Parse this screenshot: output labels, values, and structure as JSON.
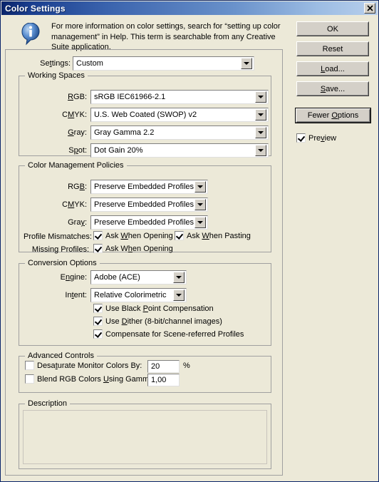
{
  "window": {
    "title": "Color Settings",
    "close_icon": "close-icon"
  },
  "info": {
    "icon": "info-icon",
    "text": "For more information on color settings, search for “setting up color management” in Help. This term is searchable from any Creative Suite application."
  },
  "settings": {
    "label": "Settings:",
    "value": "Custom"
  },
  "working_spaces": {
    "legend": "Working Spaces",
    "rows": [
      {
        "label": "RGB:",
        "value": "sRGB IEC61966-2.1"
      },
      {
        "label": "CMYK:",
        "value": "U.S. Web Coated (SWOP) v2"
      },
      {
        "label": "Gray:",
        "value": "Gray Gamma 2.2"
      },
      {
        "label": "Spot:",
        "value": "Dot Gain 20%"
      }
    ]
  },
  "color_management_policies": {
    "legend": "Color Management Policies",
    "rows": [
      {
        "label": "RGB:",
        "value": "Preserve Embedded Profiles"
      },
      {
        "label": "CMYK:",
        "value": "Preserve Embedded Profiles"
      },
      {
        "label": "Gray:",
        "value": "Preserve Embedded Profiles"
      }
    ],
    "profile_mismatches_label": "Profile Mismatches:",
    "profile_mismatches_ask_opening": "Ask When Opening",
    "profile_mismatches_ask_pasting": "Ask When Pasting",
    "missing_profiles_label": "Missing Profiles:",
    "missing_profiles_ask_opening": "Ask When Opening"
  },
  "conversion_options": {
    "legend": "Conversion Options",
    "engine_label": "Engine:",
    "engine_value": "Adobe (ACE)",
    "intent_label": "Intent:",
    "intent_value": "Relative Colorimetric",
    "black_point": "Use Black Point Compensation",
    "use_dither": "Use Dither (8-bit/channel images)",
    "compensate": "Compensate for Scene-referred Profiles"
  },
  "advanced_controls": {
    "legend": "Advanced Controls",
    "desaturate_label": "Desaturate Monitor Colors By:",
    "desaturate_value": "20",
    "desaturate_unit": "%",
    "blend_label": "Blend RGB Colors Using Gamma:",
    "blend_value": "1,00"
  },
  "description": {
    "legend": "Description",
    "text": ""
  },
  "buttons": {
    "ok": "OK",
    "reset": "Reset",
    "load": "Load...",
    "save": "Save...",
    "fewer_options": "Fewer Options"
  },
  "preview": {
    "label": "Preview"
  },
  "colors": {
    "title_start": "#0a246a",
    "title_end": "#b8cfec",
    "face": "#ece9d8",
    "button_face": "#d4d0c8",
    "group_border": "#a0a0a0",
    "info_icon_blue": "#2a5caa"
  }
}
